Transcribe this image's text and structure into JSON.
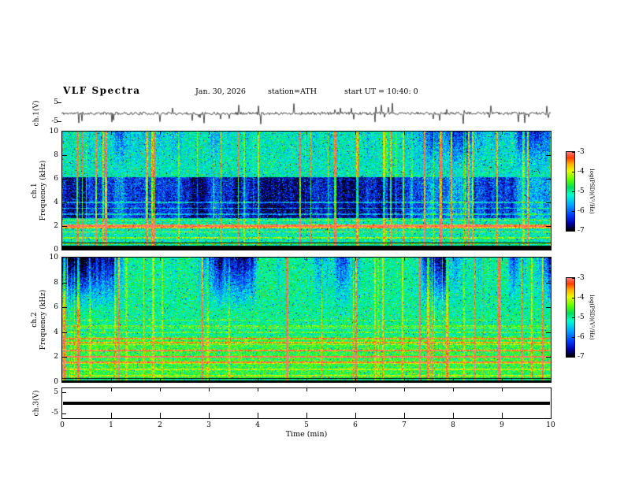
{
  "header": {
    "title": "VLF  Spectra",
    "date": "Jan. 30, 2026",
    "station": "station=ATH",
    "start_ut": "start UT =  10:40: 0"
  },
  "xaxis": {
    "label": "Time  (min)",
    "range": [
      0,
      10
    ],
    "ticks": [
      0,
      1,
      2,
      3,
      4,
      5,
      6,
      7,
      8,
      9,
      10
    ]
  },
  "colorbar": {
    "label": "log(PSD)(V²/Hz)",
    "ticks": [
      -3,
      -4,
      -5,
      -6,
      -7
    ],
    "range": [
      -7,
      -3
    ],
    "colormap_stops": [
      {
        "t": 0.0,
        "color": "#000000"
      },
      {
        "t": 0.09,
        "color": "#0000a8"
      },
      {
        "t": 0.2,
        "color": "#0040ff"
      },
      {
        "t": 0.33,
        "color": "#00a8ff"
      },
      {
        "t": 0.45,
        "color": "#00ffd0"
      },
      {
        "t": 0.55,
        "color": "#00e060"
      },
      {
        "t": 0.65,
        "color": "#60ff00"
      },
      {
        "t": 0.76,
        "color": "#e8ff00"
      },
      {
        "t": 0.85,
        "color": "#ffb400"
      },
      {
        "t": 0.93,
        "color": "#ff3c00"
      },
      {
        "t": 1.0,
        "color": "#ff7878"
      }
    ]
  },
  "colors": {
    "background": "#ffffff",
    "frame": "#000000",
    "trace": "#000000"
  },
  "chart_data": [
    {
      "id": "ch1_wave",
      "type": "line",
      "panel": "waveform",
      "ylabel": "ch.1(V)",
      "ylim": [
        -5,
        5
      ],
      "yticks": [
        5,
        -5
      ],
      "description": "broadband noisy voltage trace with impulsive sferic spikes",
      "synthesis": {
        "seed": 11,
        "noise_amp": 0.5,
        "spike_prob": 0.05,
        "spike_amp": 3.6
      }
    },
    {
      "id": "ch1_spec",
      "type": "heatmap",
      "panel": "spectrogram",
      "ylabel_line1": "ch.1",
      "ylabel_line2": "Frequency (kHz)",
      "ylim": [
        0,
        10
      ],
      "yticks": [
        0,
        2,
        4,
        6,
        8,
        10
      ],
      "clim": [
        -7,
        -3
      ],
      "description": "VLF spectrogram: green/cyan background, red vertical sferic streaks, blue band 3-6 kHz, hot band near 2 kHz, black bands near 0 kHz",
      "synthesis": {
        "seed": 42,
        "base": -5.15,
        "noise": 0.55,
        "speckle_prob": 0.035,
        "speckle_amp": 1.35,
        "streak_prob": 0.08,
        "streak_amp": 2.3,
        "blue_bands": [
          [
            2.7,
            6.1,
            1.15
          ]
        ],
        "upper_blue": {
          "fmin": 6.3,
          "depth": 0.8
        },
        "harmonics": {
          "spacing": 0.5,
          "max_freq": 4.2,
          "boost": 0.85
        },
        "hot_bands": [
          [
            1.82,
            2.12,
            1.5
          ]
        ],
        "black_bands": [
          [
            0.0,
            0.32
          ],
          [
            0.52,
            0.62
          ]
        ]
      }
    },
    {
      "id": "ch2_spec",
      "type": "heatmap",
      "panel": "spectrogram",
      "ylabel_line1": "ch.2",
      "ylabel_line2": "Frequency (kHz)",
      "ylim": [
        0,
        10
      ],
      "yticks": [
        0,
        2,
        4,
        6,
        8,
        10
      ],
      "clim": [
        -7,
        -3
      ],
      "description": "VLF spectrogram: greener lower half with orange harmonic lines, dark blue vertical blobs above ~6 kHz, red sferic streaks, black band near 0 kHz",
      "synthesis": {
        "seed": 77,
        "base": -5.0,
        "noise": 0.5,
        "speckle_prob": 0.035,
        "speckle_amp": 1.25,
        "streak_prob": 0.07,
        "streak_amp": 2.0,
        "upper_blue": {
          "fmin": 5.6,
          "depth": 1.5
        },
        "warm_band": [
          0.3,
          3.7,
          0.35
        ],
        "harmonics": {
          "spacing": 0.5,
          "max_freq": 5.0,
          "boost": 0.55
        },
        "hot_bands": [
          [
            1.55,
            1.66,
            1.3
          ],
          [
            1.95,
            2.06,
            1.5
          ],
          [
            2.5,
            2.58,
            1.1
          ],
          [
            3.12,
            3.2,
            1.0
          ],
          [
            3.44,
            3.52,
            0.95
          ],
          [
            4.3,
            4.36,
            0.8
          ]
        ],
        "black_bands": [
          [
            0.0,
            0.14
          ],
          [
            0.27,
            0.34
          ]
        ]
      }
    },
    {
      "id": "ch3_wave",
      "type": "line",
      "panel": "flat",
      "ylabel": "ch.3(V)",
      "ylim": [
        -5,
        5
      ],
      "yticks": [
        5,
        -5
      ],
      "description": "flat (saturated/zero) thick black trace at 0 V",
      "synthesis": {
        "flat_value": 0,
        "thickness": 4
      }
    }
  ]
}
